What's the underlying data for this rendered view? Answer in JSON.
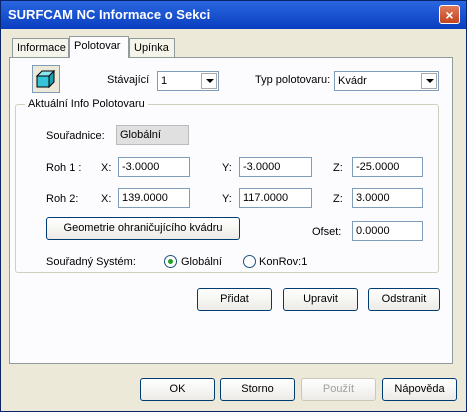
{
  "window": {
    "title": "SURFCAM NC Informace o Sekci",
    "close_icon": "×"
  },
  "tabs": [
    {
      "label": "Informace"
    },
    {
      "label": "Polotovar"
    },
    {
      "label": "Upínka"
    }
  ],
  "stock": {
    "stavajici_label": "Stávající",
    "stavajici_value": "1",
    "typ_label": "Typ polotovaru:",
    "typ_value": "Kvádr",
    "icon": "block-stock-icon"
  },
  "info_group": {
    "legend": "Aktuální Info Polotovaru",
    "souradnice_label": "Souřadnice:",
    "souradnice_value": "Globální",
    "roh1_label": "Roh 1 :",
    "roh2_label": "Roh 2:",
    "x_label": "X:",
    "y_label": "Y:",
    "z_label": "Z:",
    "roh1": {
      "x": "-3.0000",
      "y": "-3.0000",
      "z": "-25.0000"
    },
    "roh2": {
      "x": "139.0000",
      "y": "117.0000",
      "z": "3.0000"
    },
    "geometry_button": "Geometrie ohraničujícího kvádru",
    "ofset_label": "Ofset:",
    "ofset_value": "0.0000",
    "system_label": "Souřadný Systém:",
    "radio_global": "Globální",
    "radio_konrov": "KonRov:1"
  },
  "actions": {
    "pridat": "Přidat",
    "upravit": "Upravit",
    "odstranit": "Odstranit"
  },
  "footer": {
    "ok": "OK",
    "storno": "Storno",
    "pouzit": "Použít",
    "napoveda": "Nápověda"
  },
  "colors": {
    "title_bar": "#0a3ec0",
    "stock_icon": "#35c4d8",
    "radio_dot": "#21a121"
  }
}
